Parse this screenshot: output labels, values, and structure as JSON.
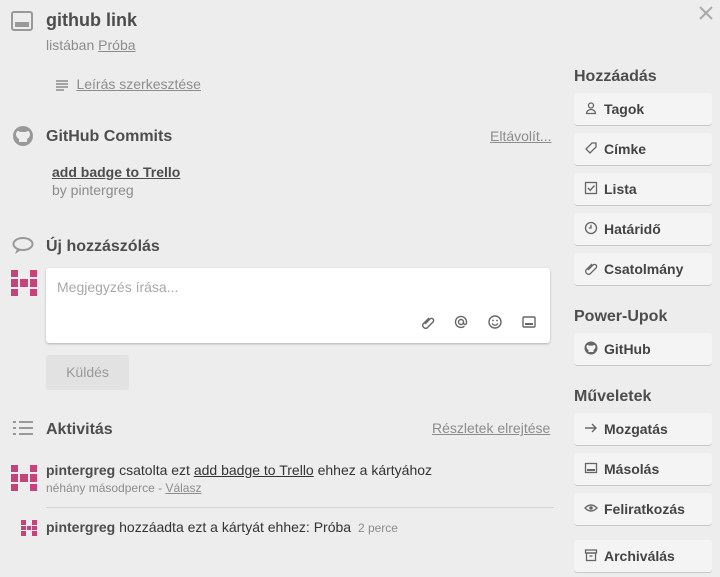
{
  "card": {
    "title": "github link",
    "list_prefix": "listában",
    "list_name": "Próba",
    "edit_desc": "Leírás szerkesztése"
  },
  "github": {
    "heading": "GitHub Commits",
    "remove": "Eltávolít...",
    "commit_title": "add badge to Trello",
    "commit_by": "by pintergreg"
  },
  "comment": {
    "heading": "Új hozzászólás",
    "placeholder": "Megjegyzés írása...",
    "send": "Küldés"
  },
  "activity": {
    "heading": "Aktivitás",
    "toggle": "Részletek elrejtése",
    "items": [
      {
        "user": "pintergreg",
        "text_a": "csatolta ezt",
        "link": "add badge to Trello",
        "text_b": "ehhez a kártyához",
        "time": "néhány másodperce",
        "dash": "-",
        "reply": "Válasz"
      },
      {
        "user": "pintergreg",
        "text": "hozzáadta ezt a kártyát ehhez: Próba",
        "time": "2 perce"
      }
    ]
  },
  "sidebar": {
    "add_heading": "Hozzáadás",
    "add_items": [
      {
        "label": "Tagok",
        "icon": "person-icon"
      },
      {
        "label": "Címke",
        "icon": "tag-icon"
      },
      {
        "label": "Lista",
        "icon": "checklist-icon"
      },
      {
        "label": "Határidő",
        "icon": "clock-icon"
      },
      {
        "label": "Csatolmány",
        "icon": "paperclip-icon"
      }
    ],
    "powerups_heading": "Power-Upok",
    "powerups": [
      {
        "label": "GitHub",
        "icon": "github-icon"
      }
    ],
    "actions_heading": "Műveletek",
    "actions": [
      {
        "label": "Mozgatás",
        "icon": "arrow-right-icon"
      },
      {
        "label": "Másolás",
        "icon": "card-icon"
      },
      {
        "label": "Feliratkozás",
        "icon": "eye-icon"
      },
      {
        "label": "Archiválás",
        "icon": "archive-icon"
      }
    ]
  },
  "colors": {
    "avatar": "#c5437a",
    "accent_text": "#4d4d4d"
  }
}
